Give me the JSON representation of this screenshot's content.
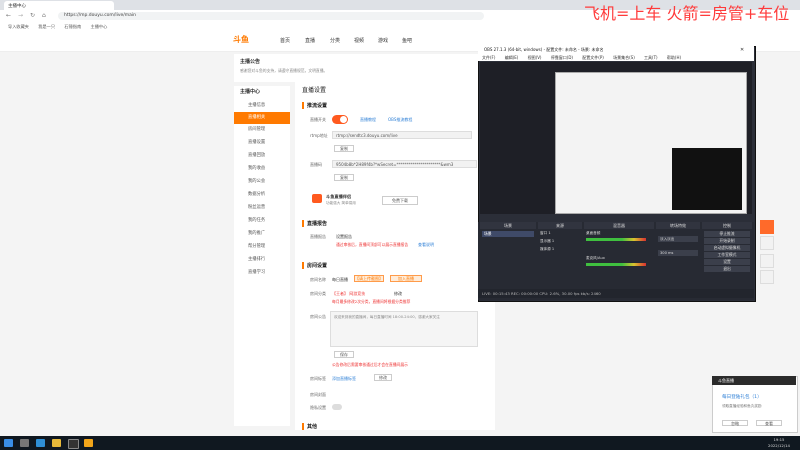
{
  "browser": {
    "tab_title": "主播中心",
    "url": "https://mp.douyu.com/live/main",
    "bookmarks": [
      "导入收藏夹",
      "我是一只",
      "石锤指南",
      "主播中心"
    ]
  },
  "overlay_text": "飞机=上车 火箭=房管+车位",
  "site": {
    "logo": "斗鱼",
    "nav": [
      "首页",
      "直播",
      "分类",
      "视频",
      "游戏",
      "鱼吧"
    ]
  },
  "notice": {
    "title": "主播公告",
    "text": "感谢您对斗鱼的支持，请遵守直播规范，文明直播。"
  },
  "sidebar": {
    "header": "主播中心",
    "items": [
      "主播信息",
      "直播相关",
      "房间管理",
      "直播设置",
      "直播回放",
      "我的收益",
      "我的公会",
      "数据分析",
      "粉丝运营",
      "我的任务",
      "我的推广",
      "帮分管理",
      "主播排行",
      "直播学习"
    ],
    "active_index": 1
  },
  "main": {
    "page_title": "直播设置",
    "push": {
      "title": "推流设置",
      "switch_label": "直播开关",
      "switch_link": "直播教程",
      "switch_link2": "OBS推流教程",
      "rtmp_label": "rtmp地址",
      "rtmp_value": "rtmp://sendtc3.douyu.com/live",
      "copy_label": "复制",
      "code_label": "直播码",
      "code_value": "9504b8b*2H89f4b?*wSecret=**********************&wm3",
      "tool_name": "斗鱼直播伴侣",
      "tool_desc": "功能强大 简单易用",
      "download_label": "免费下载"
    },
    "report": {
      "title": "直播报告",
      "label": "直播报告",
      "value": "设置报告",
      "note": "通过审核后，直播间顶部可以展示直播报告",
      "link": "查看说明"
    },
    "room": {
      "title": "房间设置",
      "name_label": "房间名称",
      "name_value": "每日直播",
      "name_btn": "【请上传截图】",
      "name_btn2": "加入直播",
      "cat_label": "房间分类",
      "cat_value": "【王者】 网游竞技",
      "cat_edit": "修改",
      "cat_note": "每月最多修改2次分类，直播间将根据分类推荐",
      "announce_label": "房间公告",
      "announce_value": "欢迎来到我的直播间，每日直播时间 18:00-24:00，感谢大家关注",
      "save_label": "保存",
      "save_note": "公告修改后需要审核通过后才会在直播间展示",
      "tag_label": "房间标签",
      "tag_value": "添加直播标签",
      "tag_edit": "修改",
      "cover_label": "房间封面",
      "privacy_label": "隐私设置"
    },
    "other_title": "其他"
  },
  "obs": {
    "title": "OBS 27.1.3 (64-bit, windows) - 配置文件: 未命名 - 场景: 未命名",
    "menu": [
      "文件(F)",
      "编辑(E)",
      "视图(V)",
      "停靠窗口(D)",
      "配置文件(P)",
      "场景集合(S)",
      "工具(T)",
      "帮助(H)"
    ],
    "docks": [
      "场景",
      "来源",
      "混音器",
      "转场特效",
      "控制"
    ],
    "scene": "场景",
    "sources": [
      "窗口 1",
      "显示器 1",
      "媒体源 1"
    ],
    "mixer": [
      "桌面音频",
      "麦克风/Aux"
    ],
    "transition": "淡入淡出",
    "duration": "300 ms",
    "controls": [
      "停止推流",
      "开始录制",
      "启动虚拟摄像机",
      "工作室模式",
      "设置",
      "退出"
    ],
    "status": "LIVE: 00:15:43   REC: 00:00:00   CPU: 2.6%, 30.00 fps   kb/s: 2460"
  },
  "notification": {
    "header": "斗鱼直播",
    "title": "每日登陆礼包（1）",
    "text": "领取直播经验和鱼丸奖励",
    "actions": [
      "忽略",
      "查看"
    ]
  },
  "taskbar": {
    "time": "19:15",
    "date": "2022/12/14"
  }
}
